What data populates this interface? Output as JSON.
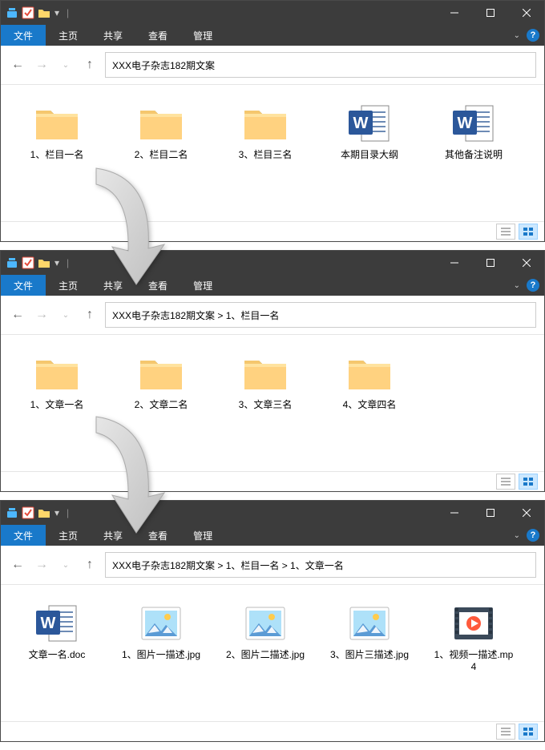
{
  "ribbon": {
    "file": "文件",
    "home": "主页",
    "share": "共享",
    "view": "查看",
    "manage": "管理"
  },
  "windows": [
    {
      "path": "XXX电子杂志182期文案",
      "items": [
        {
          "type": "folder",
          "label": "1、栏目一名"
        },
        {
          "type": "folder",
          "label": "2、栏目二名"
        },
        {
          "type": "folder",
          "label": "3、栏目三名"
        },
        {
          "type": "word",
          "label": "本期目录大纲"
        },
        {
          "type": "word",
          "label": "其他备注说明"
        }
      ]
    },
    {
      "path": "XXX电子杂志182期文案 > 1、栏目一名",
      "items": [
        {
          "type": "folder",
          "label": "1、文章一名"
        },
        {
          "type": "folder",
          "label": "2、文章二名"
        },
        {
          "type": "folder",
          "label": "3、文章三名"
        },
        {
          "type": "folder",
          "label": "4、文章四名"
        }
      ]
    },
    {
      "path": "XXX电子杂志182期文案 > 1、栏目一名 > 1、文章一名",
      "items": [
        {
          "type": "word",
          "label": "文章一名.doc"
        },
        {
          "type": "image",
          "label": "1、图片一描述.jpg"
        },
        {
          "type": "image",
          "label": "2、图片二描述.jpg"
        },
        {
          "type": "image",
          "label": "3、图片三描述.jpg"
        },
        {
          "type": "video",
          "label": "1、视频一描述.mp4"
        }
      ]
    }
  ]
}
